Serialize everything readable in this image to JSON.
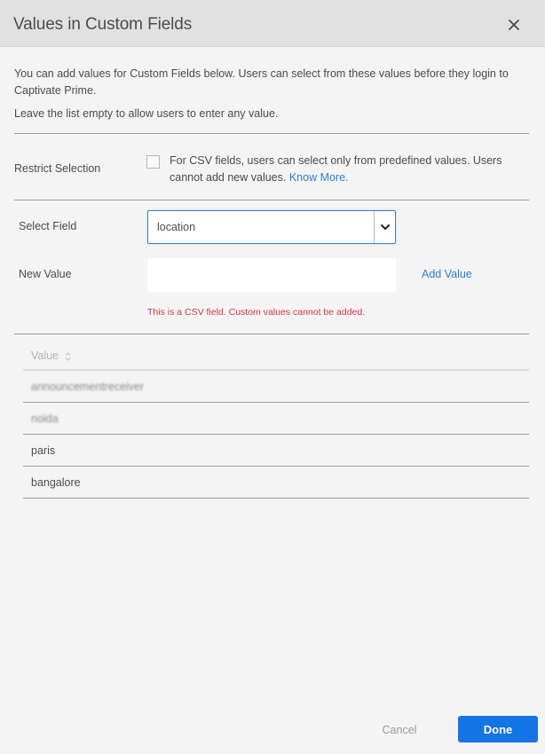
{
  "dialog": {
    "title": "Values in Custom Fields",
    "close_icon": "close-icon"
  },
  "intro": {
    "line1": "You can add values for Custom Fields below. Users can select from these values before they login to Captivate Prime.",
    "line2": "Leave the list empty to allow users to enter any value."
  },
  "restrict": {
    "label": "Restrict Selection",
    "checked": false,
    "description": "For CSV fields, users can select only from predefined values. Users cannot add new values.",
    "link": "Know More."
  },
  "select_field": {
    "label": "Select Field",
    "value": "location",
    "icon": "chevron-down-icon"
  },
  "new_value": {
    "label": "New Value",
    "value": "",
    "placeholder": "",
    "add_label": "Add Value",
    "error": "This is a CSV field. Custom values cannot be added."
  },
  "table": {
    "header": "Value",
    "sort_icon": "sort-icon",
    "rows": [
      {
        "value": "announcementreceiver",
        "blurred": true
      },
      {
        "value": "noida",
        "blurred": true
      },
      {
        "value": "paris",
        "blurred": false
      },
      {
        "value": "bangalore",
        "blurred": false
      }
    ]
  },
  "footer": {
    "cancel": "Cancel",
    "done": "Done"
  },
  "colors": {
    "accent": "#1473e6",
    "link": "#2d7fd6",
    "error": "#d7373f",
    "header_bg": "#e1e1e1",
    "body_bg": "#f4f4f4"
  }
}
